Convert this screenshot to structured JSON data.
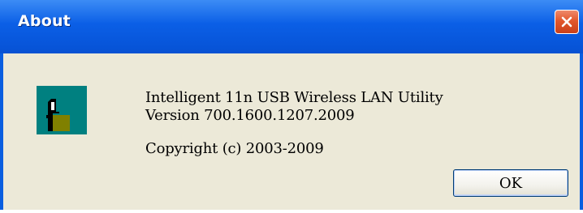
{
  "window": {
    "title": "About",
    "close_icon": "close-icon"
  },
  "content": {
    "app_icon": "app-icon",
    "product_name": "Intelligent 11n USB Wireless LAN Utility",
    "version": "Version 700.1600.1207.2009",
    "copyright": "Copyright (c) 2003-2009"
  },
  "buttons": {
    "ok_label": "OK"
  },
  "colors": {
    "title_bar": "#0b5fe6",
    "body_bg": "#ece9d8",
    "close_button": "#e2582d",
    "icon_bg": "#008080",
    "icon_box": "#808000"
  }
}
